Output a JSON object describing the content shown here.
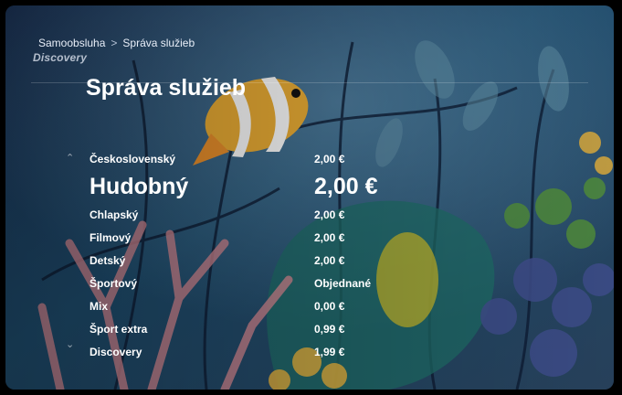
{
  "breadcrumb": {
    "root": "Samoobsluha",
    "separator": ">",
    "current": "Správa služieb"
  },
  "channel_logo": "Discovery",
  "page_title": "Správa služieb",
  "services": [
    {
      "name": "Československý",
      "price": "2,00 €"
    },
    {
      "name": "Hudobný",
      "price": "2,00 €",
      "focused": true
    },
    {
      "name": "Chlapský",
      "price": "2,00 €"
    },
    {
      "name": "Filmový",
      "price": "2,00 €"
    },
    {
      "name": "Detský",
      "price": "2,00 €"
    },
    {
      "name": "Športový",
      "price": "Objednané"
    },
    {
      "name": "Mix",
      "price": "0,00 €"
    },
    {
      "name": "Šport extra",
      "price": "0,99 €"
    },
    {
      "name": "Discovery",
      "price": "1,99 €"
    }
  ],
  "icons": {
    "scroll_up": "chevron-up-icon",
    "scroll_down": "chevron-down-icon"
  }
}
